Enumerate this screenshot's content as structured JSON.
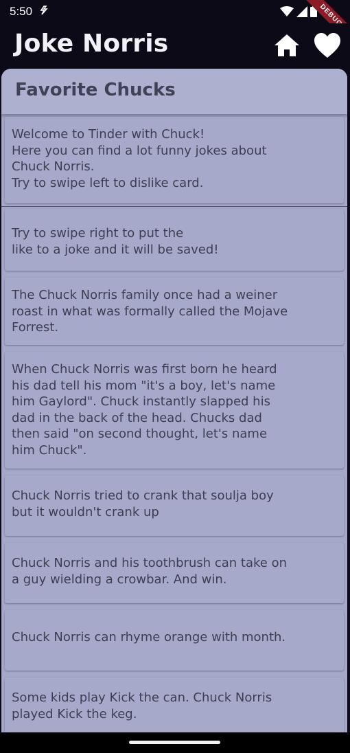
{
  "status_bar": {
    "time": "5:50",
    "debug_label": "DEBUG",
    "icons": [
      "notification-icon",
      "wifi-icon",
      "signal-icon",
      "battery-icon"
    ]
  },
  "app_bar": {
    "title": "Joke Norris",
    "home_icon": "home-icon",
    "favorite_icon": "heart-icon"
  },
  "panel": {
    "title": "Favorite Chucks"
  },
  "cards": [
    {
      "text": "Welcome to Tinder with Chuck!\nHere you can find a lot funny jokes about\nChuck Norris.\nTry to swipe left to dislike card."
    },
    {
      "text": "Try to swipe right to put the\nlike to a joke and it will be saved!"
    },
    {
      "text": "The Chuck Norris family once had a weiner\nroast in what was formally called the Mojave\nForrest."
    },
    {
      "text": "When Chuck Norris was first born he heard\nhis dad tell his mom \"it's a boy, let's name\nhim Gaylord\". Chuck instantly slapped his\ndad in the back of the head. Chucks dad\nthen said \"on second thought, let's name\nhim Chuck\"."
    },
    {
      "text": "Chuck Norris tried to crank that soulja boy\nbut it wouldn't crank up"
    },
    {
      "text": "Chuck Norris and his toothbrush can take on\na guy wielding a crowbar. And win."
    },
    {
      "text": "Chuck Norris can rhyme orange with month."
    },
    {
      "text": "Some kids play Kick the can. Chuck Norris\nplayed Kick the keg."
    }
  ],
  "colors": {
    "app_background": "#0c0a16",
    "panel_background": "#a6a8c9",
    "card_text": "#3c3e52",
    "title_text": "#f3f1f7"
  }
}
